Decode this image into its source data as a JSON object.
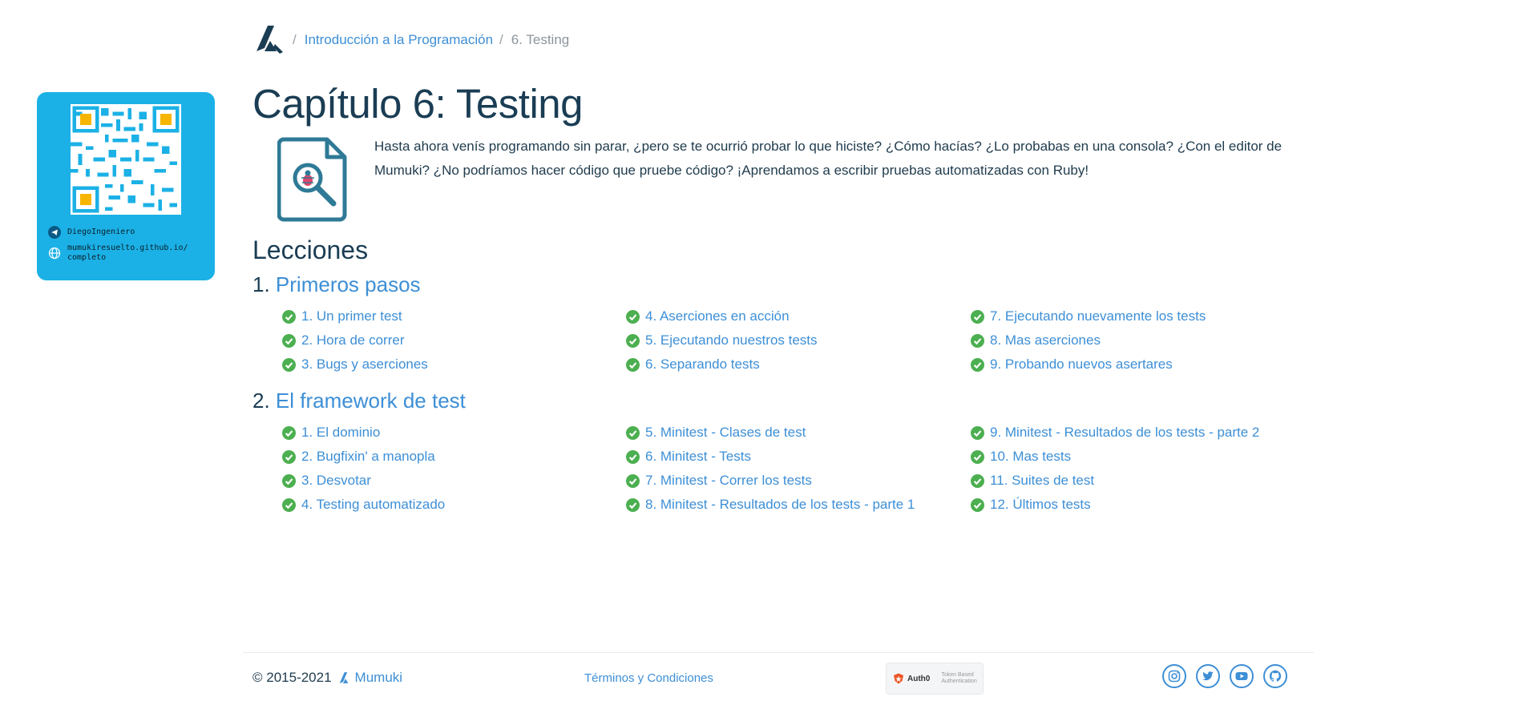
{
  "breadcrumb": {
    "separator": "/",
    "course": "Introducción a la Programación",
    "current": "6. Testing"
  },
  "qr_card": {
    "telegram": "DiegoIngeniero",
    "website_line1": "mumukiresuelto.github.io/",
    "website_line2": "completo"
  },
  "chapter": {
    "title": "Capítulo 6: Testing",
    "intro": "Hasta ahora venís programando sin parar, ¿pero se te ocurrió probar lo que hiciste? ¿Cómo hacías? ¿Lo probabas en una consola? ¿Con el editor de Mumuki? ¿No podríamos hacer código que pruebe código? ¡Aprendamos a escribir pruebas automatizadas con Ruby!"
  },
  "lessons": {
    "title": "Lecciones",
    "sections": [
      {
        "number": "1.",
        "name": "Primeros pasos",
        "items": [
          "1. Un primer test",
          "2. Hora de correr",
          "3. Bugs y aserciones",
          "4. Aserciones en acción",
          "5. Ejecutando nuestros tests",
          "6. Separando tests",
          "7. Ejecutando nuevamente los tests",
          "8. Mas aserciones",
          "9. Probando nuevos asertares"
        ]
      },
      {
        "number": "2.",
        "name": "El framework de test",
        "items": [
          "1. El dominio",
          "2. Bugfixin' a manopla",
          "3. Desvotar",
          "4. Testing automatizado",
          "5. Minitest - Clases de test",
          "6. Minitest - Tests",
          "7. Minitest - Correr los tests",
          "8. Minitest - Resultados de los tests - parte 1",
          "9. Minitest - Resultados de los tests - parte 2",
          "10. Mas tests",
          "11. Suites de test",
          "12. Últimos tests"
        ]
      }
    ]
  },
  "footer": {
    "copyright": "© 2015-2021",
    "brand": "Mumuki",
    "terms": "Términos y Condiciones",
    "auth0_label": "Auth0",
    "auth0_tagline_1": "Token Based",
    "auth0_tagline_2": "Authentication",
    "socials": [
      "instagram-icon",
      "twitter-icon",
      "youtube-icon",
      "github-icon"
    ]
  },
  "colors": {
    "link": "#3d8fd6",
    "heading": "#1a3d54",
    "check": "#4caf50",
    "qr_card": "#1bb1e6"
  }
}
